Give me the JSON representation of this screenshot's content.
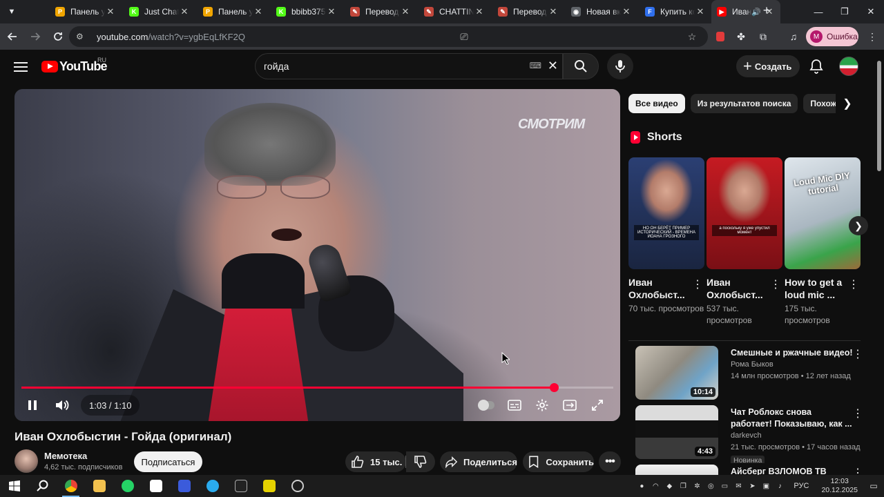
{
  "browser": {
    "tabs": [
      {
        "title": "Панель уп",
        "favicon": "P",
        "favicon_color": "#f0a500",
        "active": false
      },
      {
        "title": "Just Chatti",
        "favicon": "K",
        "favicon_color": "#53fc18",
        "active": false
      },
      {
        "title": "Панель уп",
        "favicon": "P",
        "favicon_color": "#f0a500",
        "active": false
      },
      {
        "title": "bbibb375",
        "favicon": "K",
        "favicon_color": "#53fc18",
        "active": false
      },
      {
        "title": "Перевод п",
        "favicon": "✎",
        "favicon_color": "#c2473b",
        "active": false
      },
      {
        "title": "CHATTING",
        "favicon": "✎",
        "favicon_color": "#c2473b",
        "active": false
      },
      {
        "title": "Перевод п",
        "favicon": "✎",
        "favicon_color": "#c2473b",
        "active": false
      },
      {
        "title": "Новая вкл",
        "favicon": "◉",
        "favicon_color": "#5f6368",
        "active": false
      },
      {
        "title": "Купить ко",
        "favicon": "F",
        "favicon_color": "#2f6fed",
        "active": false
      },
      {
        "title": "Иван",
        "favicon": "▶",
        "favicon_color": "#ff0000",
        "active": true
      }
    ],
    "url_host": "youtube.com",
    "url_path": "/watch?v=ygbEqLfKF2Q",
    "profile_initial": "M",
    "profile_status": "Ошибка"
  },
  "youtube": {
    "logo_text": "YouTube",
    "region": "RU",
    "search_query": "гойда",
    "create_label": "Создать",
    "player": {
      "current_time": "1:03",
      "duration": "1:10",
      "progress_fraction": 0.9,
      "watermark": "СМОТРИМ"
    },
    "video": {
      "title": "Иван Охлобыстин - Гойда (оригинал)",
      "channel": "Мемотека",
      "subscribers": "4,62 тыс. подписчиков",
      "subscribe_label": "Подписаться",
      "likes": "15 тыс.",
      "share_label": "Поделиться",
      "save_label": "Сохранить"
    },
    "chips": [
      "Все видео",
      "Из результатов поиска",
      "Похожи"
    ],
    "shorts_title": "Shorts",
    "shorts": [
      {
        "title": "Иван Охлобыст...",
        "views": "70 тыс. просмотров",
        "caption": "НО ОН БЕРЁТ ПРИМЕР ИСТОРИЧЕСКИЙ - ВРЕМЕНА ИОАНА ГРОЗНОГО",
        "color": "#2b3f73"
      },
      {
        "title": "Иван Охлобыст...",
        "views": "537 тыс. просмотров",
        "caption": "а поскольку я уже упустил момент",
        "color": "#c51b22"
      },
      {
        "title": "How to get a loud mic ...",
        "views": "175 тыс. просмотров",
        "caption": "Loud Mic DIY tutorial",
        "color": "#cfd6dd"
      }
    ],
    "recommended": [
      {
        "title": "Смешные и ржачные видео!",
        "channel": "Рома Быков",
        "meta": "14 млн просмотров • 12 лет назад",
        "duration": "10:14",
        "badge": ""
      },
      {
        "title": "Чат Роблокс снова работает! Показываю, как ...",
        "channel": "darkevch",
        "meta": "21 тыс. просмотров • 17 часов назад",
        "duration": "4:43",
        "badge": "Новинка"
      },
      {
        "title": "Айсберг ВЗЛОМОВ ТВ",
        "channel": "",
        "meta": "",
        "duration": "",
        "badge": ""
      }
    ]
  },
  "taskbar": {
    "language": "РУС",
    "time": "12:03",
    "date": "20.12.2025"
  }
}
